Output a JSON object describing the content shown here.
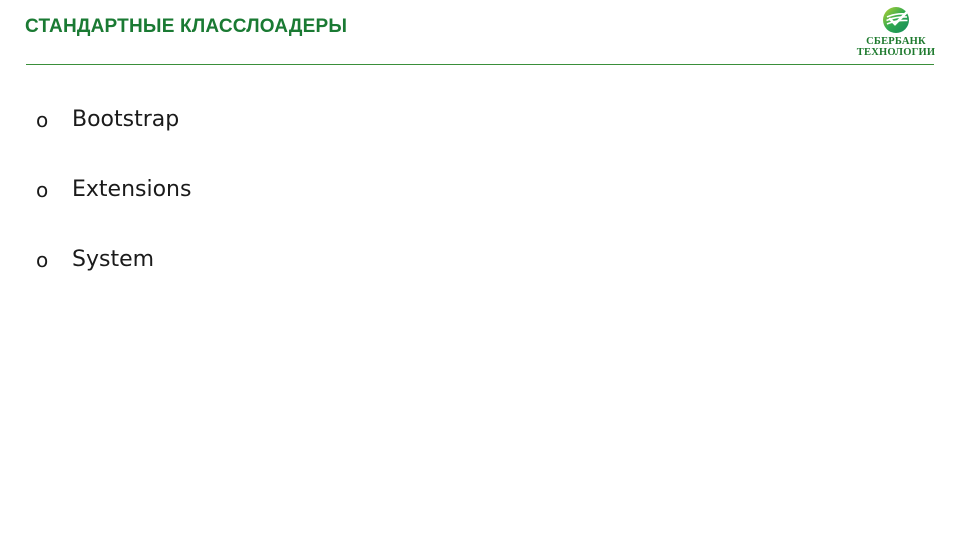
{
  "slide": {
    "title": "СТАНДАРТНЫЕ КЛАССЛОАДЕРЫ",
    "bullets": [
      {
        "marker": "o",
        "text": "Bootstrap"
      },
      {
        "marker": "o",
        "text": "Extensions"
      },
      {
        "marker": "o",
        "text": "System"
      }
    ]
  },
  "logo": {
    "line1": "СБЕРБАНК",
    "line2": "ТЕХНОЛОГИИ",
    "icon": "sberbank-logo-icon"
  },
  "colors": {
    "accent": "#1a7a33",
    "rule": "#3a8f3a",
    "text": "#1a1a1a",
    "background": "#ffffff"
  }
}
